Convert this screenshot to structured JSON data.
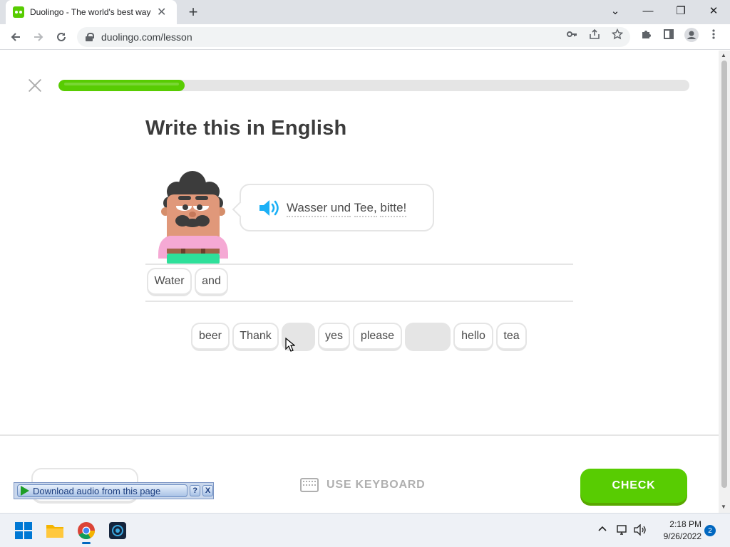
{
  "browser": {
    "tab_title": "Duolingo - The world's best way",
    "tab_close": "✕",
    "new_tab": "+",
    "url": "duolingo.com/lesson",
    "window_controls": {
      "tabs_dropdown": "⌄",
      "minimize": "—",
      "restore": "❐",
      "close": "✕"
    }
  },
  "lesson": {
    "progress_percent": 20,
    "title": "Write this in English",
    "prompt": {
      "words": [
        "Wasser",
        "und",
        "Tee,",
        "bitte!"
      ]
    },
    "answer_chips": [
      "Water",
      "and"
    ],
    "word_bank": [
      {
        "label": "beer",
        "used": false
      },
      {
        "label": "Thank",
        "used": false
      },
      {
        "label": "",
        "used": true
      },
      {
        "label": "yes",
        "used": false
      },
      {
        "label": "please",
        "used": false
      },
      {
        "label": "",
        "used": true
      },
      {
        "label": "hello",
        "used": false
      },
      {
        "label": "tea",
        "used": false
      }
    ],
    "use_keyboard_label": "USE KEYBOARD",
    "check_label": "CHECK"
  },
  "extension_bar": {
    "download_label": "Download audio from this page",
    "help": "?",
    "close": "X"
  },
  "taskbar": {
    "time": "2:18 PM",
    "date": "9/26/2022",
    "notifications": "2"
  },
  "colors": {
    "accent_green": "#58cc02",
    "text_dark": "#3c3c3c",
    "border_gray": "#e5e5e5",
    "speaker_blue": "#1cb0f6"
  }
}
